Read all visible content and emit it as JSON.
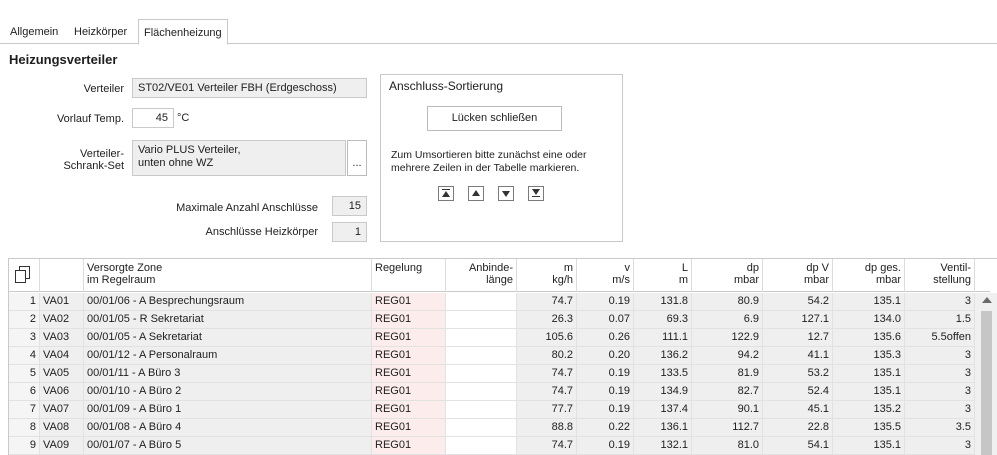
{
  "tabs": [
    "Allgemein",
    "Heizkörper",
    "Flächenheizung"
  ],
  "section_title": "Heizungsverteiler",
  "form": {
    "verteiler_label": "Verteiler",
    "verteiler_value": "ST02/VE01 Verteiler FBH  (Erdgeschoss)",
    "vorlauf_label": "Vorlauf Temp.",
    "vorlauf_value": "45",
    "vorlauf_unit": "°C",
    "schrank_label_1": "Verteiler-",
    "schrank_label_2": "Schrank-Set",
    "schrank_value_1": "Vario PLUS Verteiler,",
    "schrank_value_2": "unten ohne WZ",
    "browse_label": "...",
    "max_label": "Maximale Anzahl Anschlüsse",
    "max_value": "15",
    "hk_label": "Anschlüsse Heizkörper",
    "hk_value": "1"
  },
  "sort_group": {
    "title": "Anschluss-Sortierung",
    "button": "Lücken schließen",
    "hint": "Zum Umsortieren bitte zunächst eine oder mehrere Zeilen in der Tabelle markieren."
  },
  "table": {
    "headers": [
      {
        "l1": "",
        "l2": ""
      },
      {
        "l1": "",
        "l2": ""
      },
      {
        "l1": "Versorgte Zone",
        "l2": "im Regelraum"
      },
      {
        "l1": "Regelung",
        "l2": ""
      },
      {
        "l1": "Anbinde-",
        "l2": "länge"
      },
      {
        "l1": "m",
        "l2": "kg/h"
      },
      {
        "l1": "v",
        "l2": "m/s"
      },
      {
        "l1": "L",
        "l2": "m"
      },
      {
        "l1": "dp",
        "l2": "mbar"
      },
      {
        "l1": "dp V",
        "l2": "mbar"
      },
      {
        "l1": "dp ges.",
        "l2": "mbar"
      },
      {
        "l1": "Ventil-",
        "l2": "stellung"
      }
    ],
    "rows": [
      [
        "1",
        "VA01",
        "00/01/06 - A Besprechungsraum",
        "REG01",
        "",
        "74.7",
        "0.19",
        "131.8",
        "80.9",
        "54.2",
        "135.1",
        "3"
      ],
      [
        "2",
        "VA02",
        "00/01/05 - R Sekretariat",
        "REG01",
        "",
        "26.3",
        "0.07",
        "69.3",
        "6.9",
        "127.1",
        "134.0",
        "1.5"
      ],
      [
        "3",
        "VA03",
        "00/01/05 - A Sekretariat",
        "REG01",
        "",
        "105.6",
        "0.26",
        "111.1",
        "122.9",
        "12.7",
        "135.6",
        "5.5offen"
      ],
      [
        "4",
        "VA04",
        "00/01/12 - A Personalraum",
        "REG01",
        "",
        "80.2",
        "0.20",
        "136.2",
        "94.2",
        "41.1",
        "135.3",
        "3"
      ],
      [
        "5",
        "VA05",
        "00/01/11 - A Büro 3",
        "REG01",
        "",
        "74.7",
        "0.19",
        "133.5",
        "81.9",
        "53.2",
        "135.1",
        "3"
      ],
      [
        "6",
        "VA06",
        "00/01/10 - A Büro 2",
        "REG01",
        "",
        "74.7",
        "0.19",
        "134.9",
        "82.7",
        "52.4",
        "135.1",
        "3"
      ],
      [
        "7",
        "VA07",
        "00/01/09 - A Büro 1",
        "REG01",
        "",
        "77.7",
        "0.19",
        "137.4",
        "90.1",
        "45.1",
        "135.2",
        "3"
      ],
      [
        "8",
        "VA08",
        "00/01/08 - A Büro 4",
        "REG01",
        "",
        "88.8",
        "0.22",
        "136.1",
        "112.7",
        "22.8",
        "135.5",
        "3.5"
      ],
      [
        "9",
        "VA09",
        "00/01/07 - A Büro 5",
        "REG01",
        "",
        "74.7",
        "0.19",
        "132.1",
        "81.0",
        "54.1",
        "135.1",
        "3"
      ]
    ]
  }
}
